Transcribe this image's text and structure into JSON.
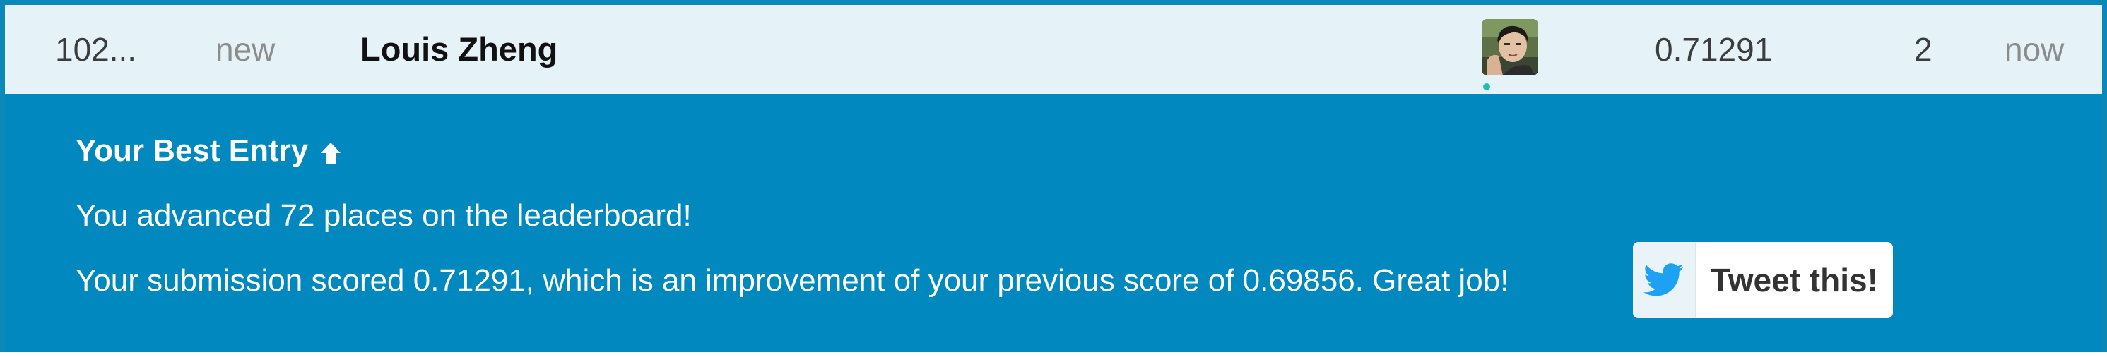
{
  "leaderboard_row": {
    "rank": "102...",
    "change": "new",
    "team_name": "Louis Zheng",
    "avatar_icon": "user-avatar",
    "online_status_color": "#20beb1",
    "score": "0.71291",
    "entries": "2",
    "last": "now"
  },
  "best_entry_panel": {
    "heading": "Your Best Entry",
    "heading_icon": "arrow-up-icon",
    "advanced_text": "You advanced 72 places on the leaderboard!",
    "improvement_text": "Your submission scored 0.71291, which is an improvement of your previous score of 0.69856. Great job!",
    "tweet_button_label": "Tweet this!",
    "tweet_icon": "twitter-bird-icon",
    "background_color": "#0088bf",
    "twitter_color": "#1da1f2"
  }
}
